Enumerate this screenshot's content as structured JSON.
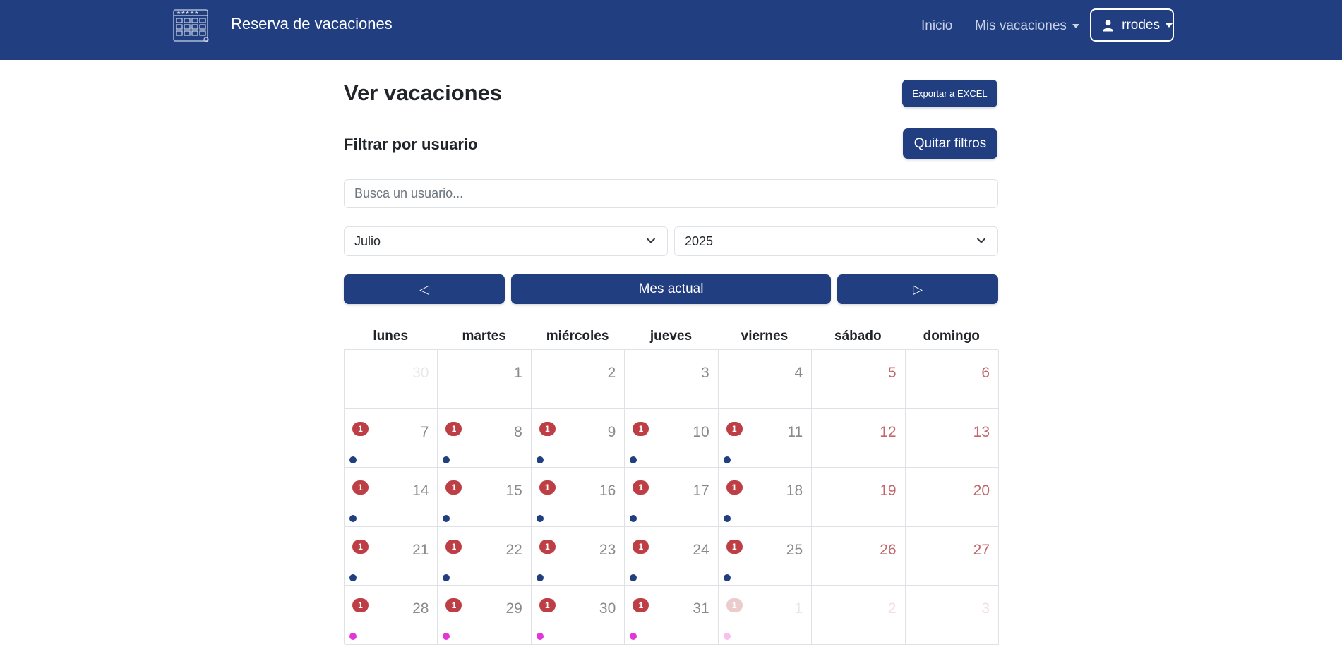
{
  "navbar": {
    "brand_title": "Reserva de vacaciones",
    "links": {
      "inicio": "Inicio",
      "mis_vacaciones": "Mis vacaciones"
    },
    "user": "rrodes",
    "color": "#213f80"
  },
  "page": {
    "title": "Ver vacaciones",
    "export_label": "Exportar a EXCEL",
    "filter_title": "Filtrar por usuario",
    "clear_filters_label": "Quitar filtros",
    "search_placeholder": "Busca un usuario...",
    "month_selected": "Julio",
    "year_selected": "2025",
    "prev_icon": "◁",
    "today_label": "Mes actual",
    "next_icon": "▷"
  },
  "calendar": {
    "weekdays": [
      "lunes",
      "martes",
      "miércoles",
      "jueves",
      "viernes",
      "sábado",
      "domingo"
    ],
    "colors": {
      "dot_blue": "#213f80",
      "dot_magenta": "#e336d8",
      "dot_faded": "#f6c1ef",
      "badge": "#bd3f45"
    },
    "weeks": [
      [
        {
          "day": "30",
          "other": true
        },
        {
          "day": "1"
        },
        {
          "day": "2"
        },
        {
          "day": "3"
        },
        {
          "day": "4"
        },
        {
          "day": "5",
          "weekend": true
        },
        {
          "day": "6",
          "weekend": true
        }
      ],
      [
        {
          "day": "7",
          "badge": "1",
          "dot": "blue"
        },
        {
          "day": "8",
          "badge": "1",
          "dot": "blue"
        },
        {
          "day": "9",
          "badge": "1",
          "dot": "blue"
        },
        {
          "day": "10",
          "badge": "1",
          "dot": "blue"
        },
        {
          "day": "11",
          "badge": "1",
          "dot": "blue"
        },
        {
          "day": "12",
          "weekend": true
        },
        {
          "day": "13",
          "weekend": true
        }
      ],
      [
        {
          "day": "14",
          "badge": "1",
          "dot": "blue"
        },
        {
          "day": "15",
          "badge": "1",
          "dot": "blue"
        },
        {
          "day": "16",
          "badge": "1",
          "dot": "blue"
        },
        {
          "day": "17",
          "badge": "1",
          "dot": "blue"
        },
        {
          "day": "18",
          "badge": "1",
          "dot": "blue"
        },
        {
          "day": "19",
          "weekend": true
        },
        {
          "day": "20",
          "weekend": true
        }
      ],
      [
        {
          "day": "21",
          "badge": "1",
          "dot": "blue"
        },
        {
          "day": "22",
          "badge": "1",
          "dot": "blue"
        },
        {
          "day": "23",
          "badge": "1",
          "dot": "blue"
        },
        {
          "day": "24",
          "badge": "1",
          "dot": "blue"
        },
        {
          "day": "25",
          "badge": "1",
          "dot": "blue"
        },
        {
          "day": "26",
          "weekend": true
        },
        {
          "day": "27",
          "weekend": true
        }
      ],
      [
        {
          "day": "28",
          "badge": "1",
          "dot": "magenta"
        },
        {
          "day": "29",
          "badge": "1",
          "dot": "magenta"
        },
        {
          "day": "30",
          "badge": "1",
          "dot": "magenta"
        },
        {
          "day": "31",
          "badge": "1",
          "dot": "magenta"
        },
        {
          "day": "1",
          "other": true,
          "badge": "1",
          "dot": "faded"
        },
        {
          "day": "2",
          "other": true,
          "weekend": true
        },
        {
          "day": "3",
          "other": true,
          "weekend": true
        }
      ]
    ]
  }
}
